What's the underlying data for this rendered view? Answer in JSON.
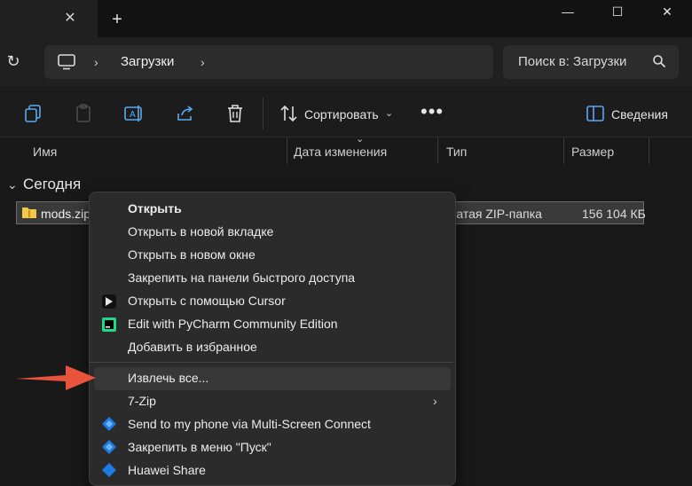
{
  "window": {
    "tab_close": "✕",
    "new_tab": "+",
    "minimize": "—",
    "maximize": "☐",
    "close": "✕"
  },
  "address": {
    "crumb": "Загрузки",
    "search_placeholder": "Поиск в: Загрузки"
  },
  "toolbar": {
    "sort_label": "Сортировать",
    "more_label": "•••",
    "details_label": "Сведения"
  },
  "columns": {
    "name": "Имя",
    "date": "Дата изменения",
    "type": "Тип",
    "size": "Размер"
  },
  "files": {
    "group": "Сегодня",
    "items": [
      {
        "name": "mods.zip",
        "type": "жатая ZIP-папка",
        "size": "156 104 КБ"
      }
    ]
  },
  "menu": {
    "items": [
      {
        "label": "Открыть"
      },
      {
        "label": "Открыть в новой вкладке"
      },
      {
        "label": "Открыть в новом окне"
      },
      {
        "label": "Закрепить на панели быстрого доступа"
      },
      {
        "label": "Открыть с помощью Cursor"
      },
      {
        "label": "Edit with PyCharm Community Edition"
      },
      {
        "label": "Добавить в избранное"
      },
      {
        "label": "Извлечь все..."
      },
      {
        "label": "7-Zip"
      },
      {
        "label": "Send to my phone via Multi-Screen Connect"
      },
      {
        "label": "Закрепить в меню \"Пуск\""
      },
      {
        "label": "Huawei Share"
      }
    ]
  },
  "colors": {
    "accent_arrow": "#e8533c",
    "folder": "#f2c84b",
    "blue_icon": "#1e7be6"
  }
}
